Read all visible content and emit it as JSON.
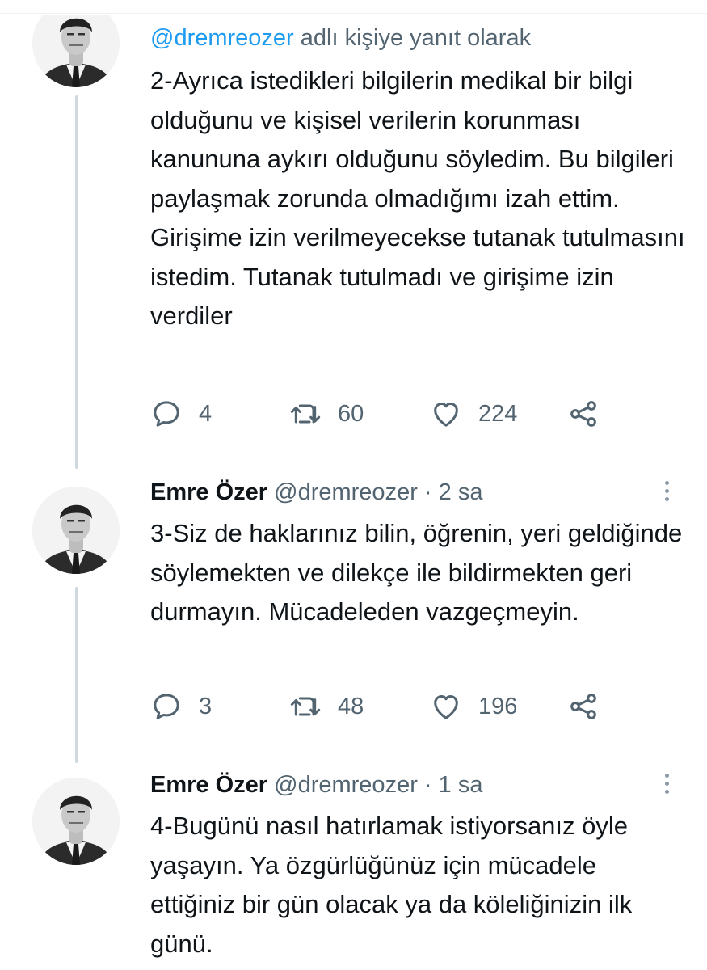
{
  "tweets": [
    {
      "reply_prefix": "@dremreozer",
      "reply_suffix": " adlı kişiye yanıt olarak",
      "text": "2-Ayrıca istedikleri bilgilerin medikal bir bilgi olduğunu ve kişisel verilerin korunması kanununa aykırı olduğunu söyledim. Bu bilgileri paylaşmak zorunda olmadığımı izah ettim. Girişime izin verilmeyecekse tutanak tutulmasını istedim. Tutanak tutulmadı ve girişime izin verdiler",
      "replies": "4",
      "retweets": "60",
      "likes": "224"
    },
    {
      "name": "Emre Özer",
      "handle": "@dremreozer",
      "dot": "·",
      "time": "2 sa",
      "text": "3-Siz de haklarınız bilin, öğrenin, yeri geldiğinde söylemekten ve dilekçe ile bildirmekten geri durmayın. Mücadeleden vazgeçmeyin.",
      "replies": "3",
      "retweets": "48",
      "likes": "196"
    },
    {
      "name": "Emre Özer",
      "handle": "@dremreozer",
      "dot": "·",
      "time": "1 sa",
      "text": "4-Bugünü nasıl hatırlamak istiyorsanız öyle yaşayın. Ya özgürlüğünüz için mücadele ettiğiniz bir gün olacak ya da köleliğinizin ilk günü."
    }
  ],
  "icons": {
    "reply": "reply-icon",
    "retweet": "retweet-icon",
    "like": "heart-icon",
    "share": "share-icon",
    "more": "more-options-icon"
  },
  "colors": {
    "mention": "#1d9bf0",
    "secondary_text": "#536471",
    "thread_line": "#cfd9de"
  }
}
